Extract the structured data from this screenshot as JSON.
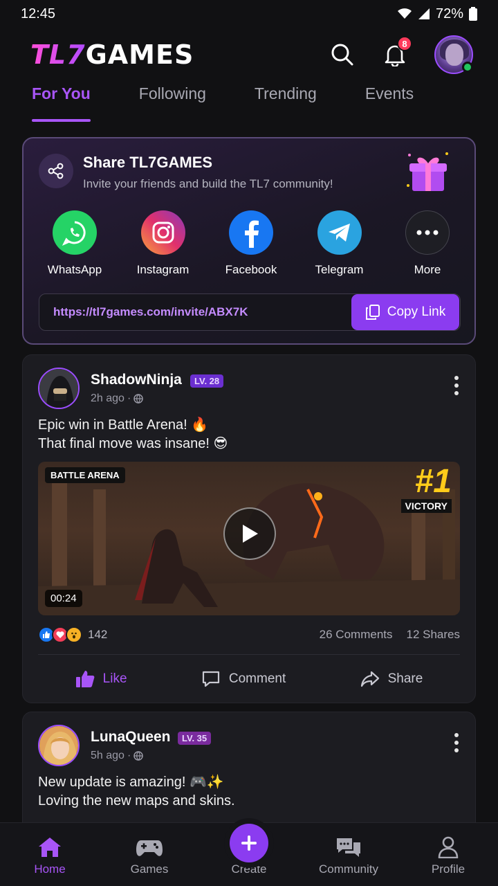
{
  "status": {
    "time": "12:45",
    "battery": "72%"
  },
  "header": {
    "logo_tl7": "TL7",
    "logo_games": "GAMES",
    "notification_count": "8"
  },
  "tabs": [
    {
      "label": "For You",
      "active": true
    },
    {
      "label": "Following",
      "active": false
    },
    {
      "label": "Trending",
      "active": false
    },
    {
      "label": "Events",
      "active": false
    }
  ],
  "share": {
    "title": "Share TL7GAMES",
    "subtitle": "Invite your friends and build the TL7 community!",
    "options": [
      {
        "label": "WhatsApp",
        "icon": "whatsapp-icon",
        "color": "#25d366"
      },
      {
        "label": "Instagram",
        "icon": "instagram-icon",
        "color": "#e1306c"
      },
      {
        "label": "Facebook",
        "icon": "facebook-icon",
        "color": "#1877f2"
      },
      {
        "label": "Telegram",
        "icon": "telegram-icon",
        "color": "#2aa3e0"
      },
      {
        "label": "More",
        "icon": "more-icon",
        "color": "#1e1e24"
      }
    ],
    "invite_link": "https://tl7games.com/invite/ABX7K",
    "copy_label": "Copy Link"
  },
  "posts": [
    {
      "user": "ShadowNinja",
      "level": "LV. 28",
      "time": "2h ago",
      "text_line1": "Epic win in Battle Arena! 🔥",
      "text_line2": "That final move was insane! 😎",
      "media_tag": "BATTLE ARENA",
      "rank": "#1",
      "rank_label": "VICTORY",
      "duration": "00:24",
      "reaction_count": "142",
      "comments": "26 Comments",
      "shares": "12 Shares"
    },
    {
      "user": "LunaQueen",
      "level": "LV. 35",
      "time": "5h ago",
      "text_line1": "New update is amazing! 🎮✨",
      "text_line2": "Loving the new maps and skins."
    }
  ],
  "post_actions": {
    "like": "Like",
    "comment": "Comment",
    "share": "Share"
  },
  "nav": {
    "home": "Home",
    "games": "Games",
    "create": "Create",
    "community": "Community",
    "profile": "Profile"
  },
  "colors": {
    "accent": "#a855f7",
    "background": "#111113",
    "card": "#1c1c21"
  }
}
